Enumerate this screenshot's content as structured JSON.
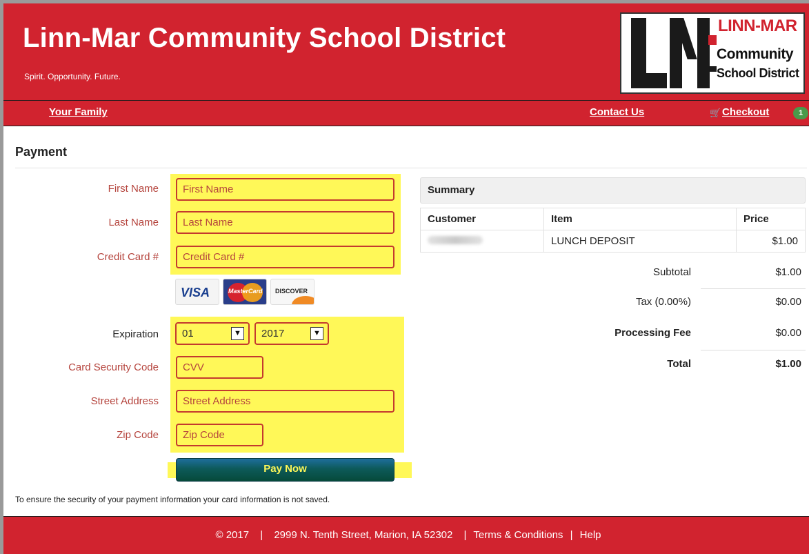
{
  "header": {
    "title": "Linn-Mar Community School District",
    "tagline": "Spirit. Opportunity. Future.",
    "logo": {
      "line1": "LINN-MAR",
      "line2": "Community",
      "line3": "School District"
    }
  },
  "nav": {
    "your_family": "Your Family",
    "contact_us": "Contact Us",
    "checkout": "Checkout",
    "cart_count": "1"
  },
  "page": {
    "heading": "Payment"
  },
  "form": {
    "first_name": {
      "label": "First Name",
      "placeholder": "First Name"
    },
    "last_name": {
      "label": "Last Name",
      "placeholder": "Last Name"
    },
    "card_number": {
      "label": "Credit Card #",
      "placeholder": "Credit Card #"
    },
    "cards": {
      "visa": "VISA",
      "mastercard": "MasterCard",
      "discover": "DISCOVER"
    },
    "expiration": {
      "label": "Expiration",
      "month": "01",
      "year": "2017"
    },
    "cvv": {
      "label": "Card Security Code",
      "placeholder": "CVV"
    },
    "street": {
      "label": "Street Address",
      "placeholder": "Street Address"
    },
    "zip": {
      "label": "Zip Code",
      "placeholder": "Zip Code"
    },
    "pay_button": "Pay Now",
    "security_note": "To ensure the security of your payment information your card information is not saved."
  },
  "summary": {
    "title": "Summary",
    "columns": [
      "Customer",
      "Item",
      "Price"
    ],
    "rows": [
      {
        "item": "LUNCH DEPOSIT",
        "price": "$1.00"
      }
    ],
    "subtotal": {
      "label": "Subtotal",
      "value": "$1.00"
    },
    "tax": {
      "label": "Tax (0.00%)",
      "value": "$0.00"
    },
    "fee": {
      "label": "Processing Fee",
      "value": "$0.00"
    },
    "total": {
      "label": "Total",
      "value": "$1.00"
    }
  },
  "footer": {
    "copyright": "© 2017",
    "address": "2999 N. Tenth Street, Marion, IA 52302",
    "terms": "Terms & Conditions",
    "help": "Help",
    "separator": "|"
  },
  "colors": {
    "brand_red": "#d1232f",
    "highlight": "#fff858",
    "field_border": "#c43a2e",
    "button": "#0d5a5a"
  }
}
